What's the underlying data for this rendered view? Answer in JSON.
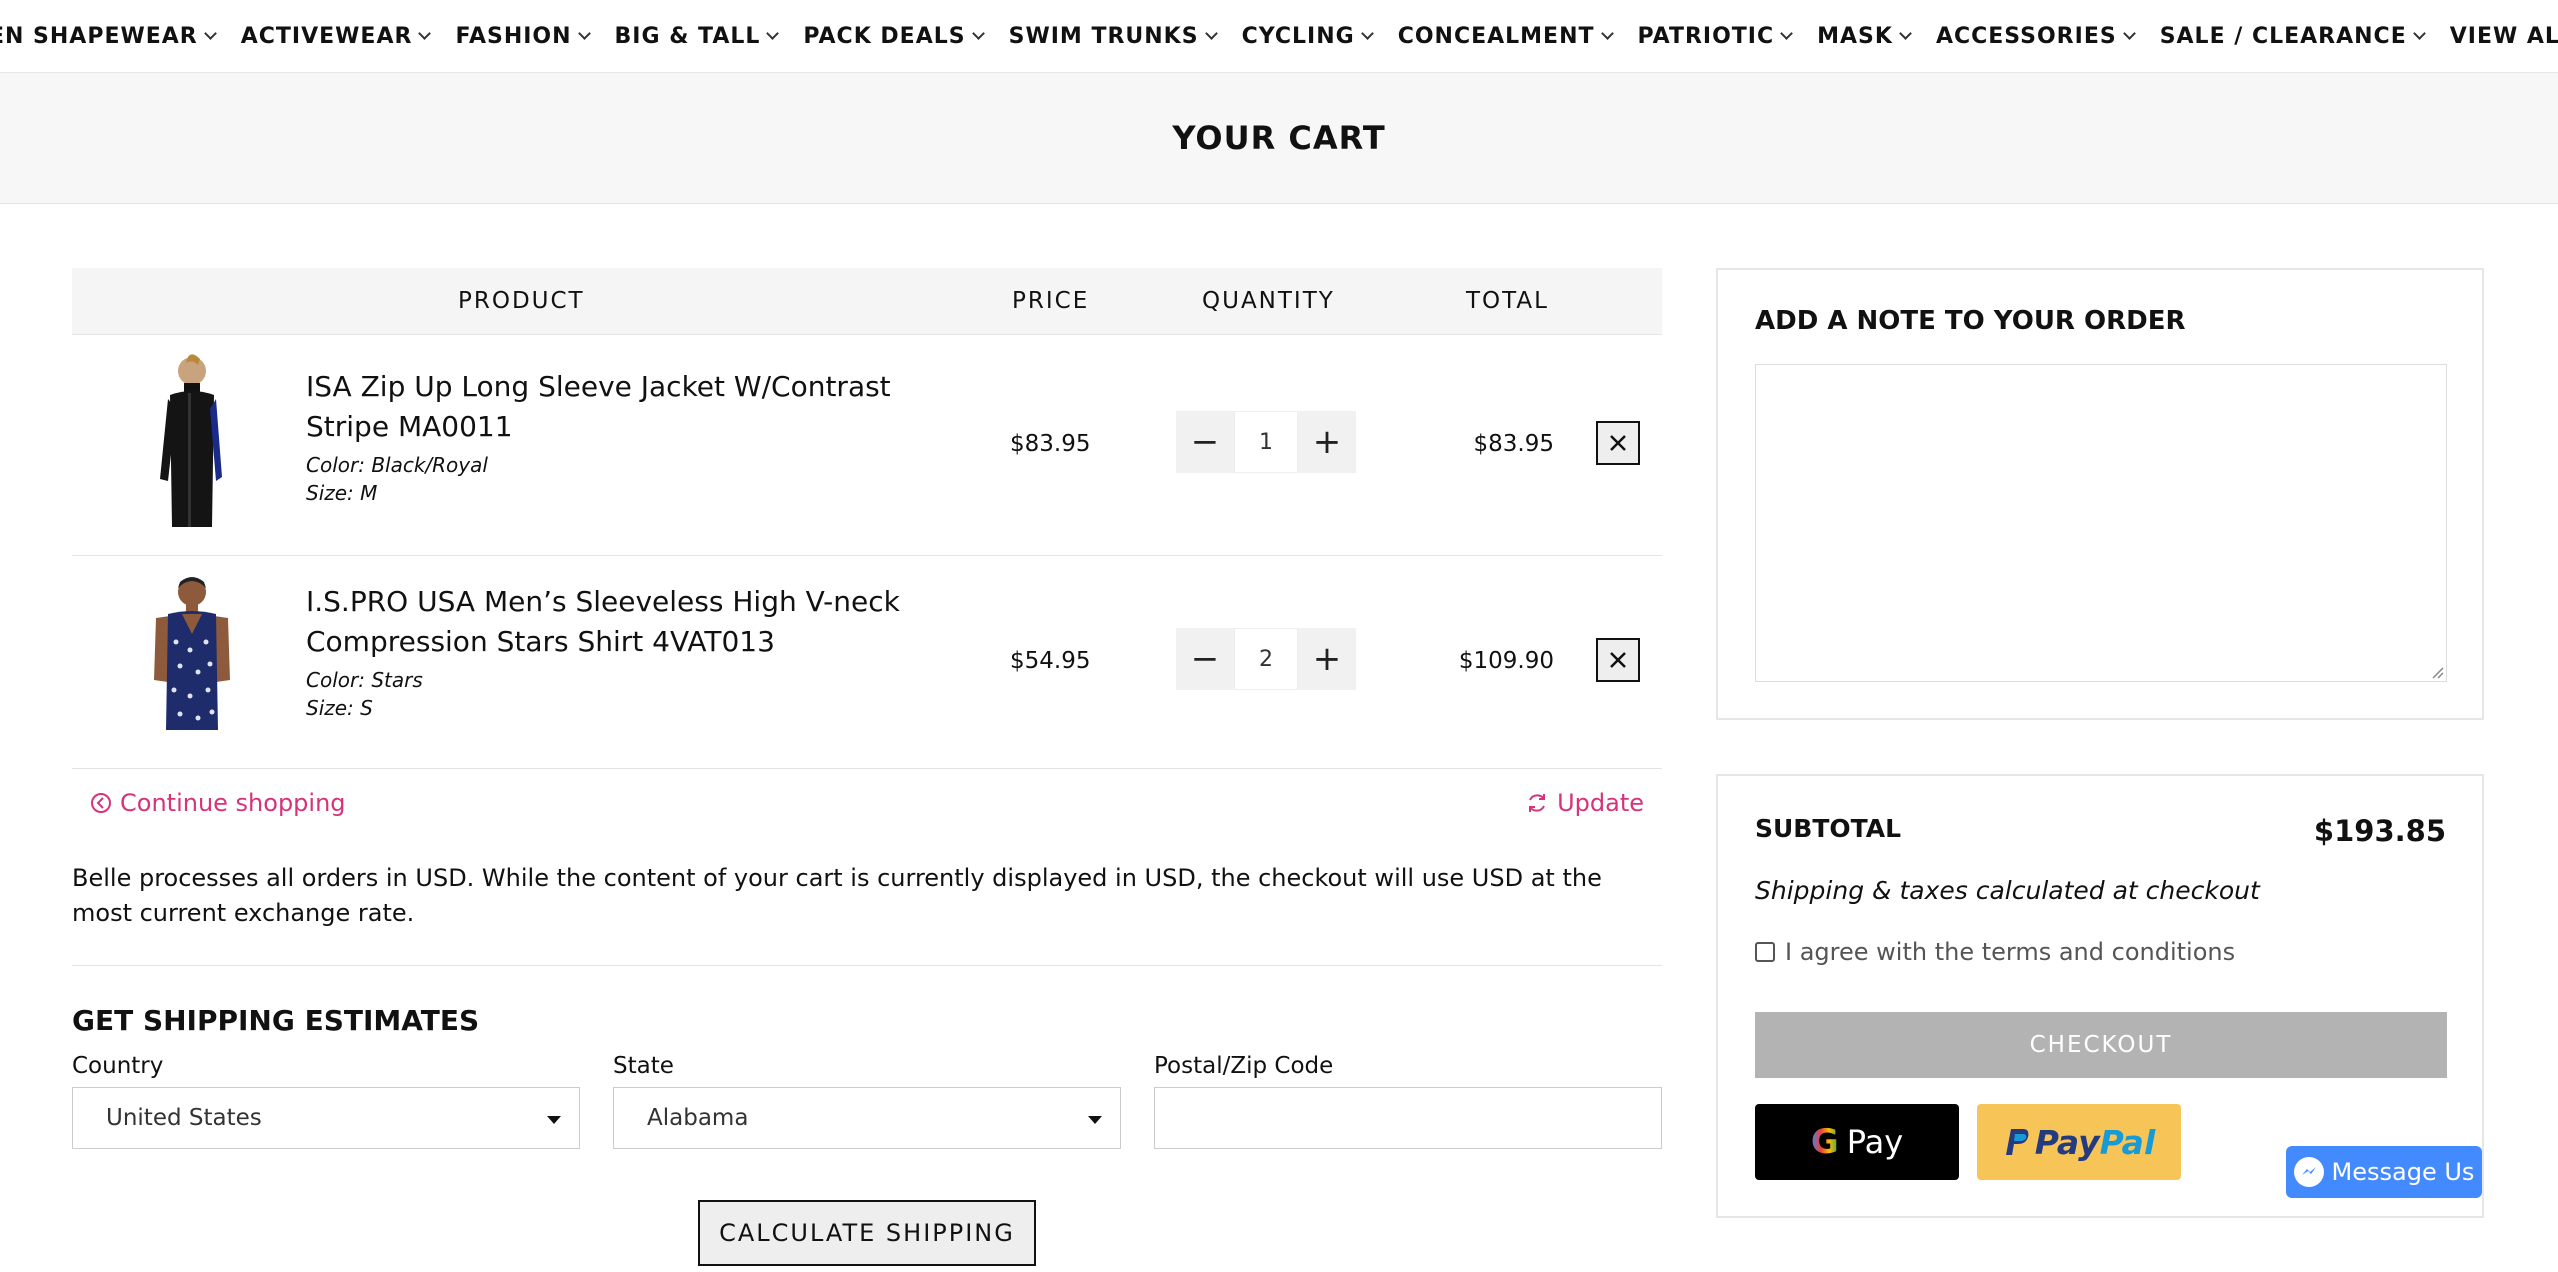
{
  "nav": {
    "items": [
      {
        "label": "MEN SHAPEWEAR"
      },
      {
        "label": "ACTIVEWEAR"
      },
      {
        "label": "FASHION"
      },
      {
        "label": "BIG & TALL"
      },
      {
        "label": "PACK DEALS"
      },
      {
        "label": "SWIM TRUNKS"
      },
      {
        "label": "CYCLING"
      },
      {
        "label": "CONCEALMENT"
      },
      {
        "label": "PATRIOTIC"
      },
      {
        "label": "MASK"
      },
      {
        "label": "ACCESSORIES"
      },
      {
        "label": "SALE / CLEARANCE"
      },
      {
        "label": "VIEW ALL"
      }
    ]
  },
  "page": {
    "title": "YOUR CART"
  },
  "table": {
    "headers": {
      "product": "PRODUCT",
      "price": "PRICE",
      "quantity": "QUANTITY",
      "total": "TOTAL"
    },
    "items": [
      {
        "name": "ISA Zip Up Long Sleeve Jacket W/Contrast Stripe MA0011",
        "color": "Color: Black/Royal",
        "size": "Size: M",
        "price": "$83.95",
        "qty": "1",
        "total": "$83.95"
      },
      {
        "name": "I.S.PRO USA Men’s Sleeveless High V-neck Compression Stars Shirt 4VAT013",
        "color": "Color: Stars",
        "size": "Size: S",
        "price": "$54.95",
        "qty": "2",
        "total": "$109.90"
      }
    ],
    "qty_minus": "−",
    "qty_plus": "+"
  },
  "actions": {
    "continue": "Continue shopping",
    "update": "Update"
  },
  "currency_note": "Belle processes all orders in USD. While the content of your cart is currently displayed in USD, the checkout will use USD at the most current exchange rate.",
  "shipping": {
    "title": "GET SHIPPING ESTIMATES",
    "country_label": "Country",
    "country_value": "United States",
    "state_label": "State",
    "state_value": "Alabama",
    "zip_label": "Postal/Zip Code",
    "zip_value": "",
    "button": "CALCULATE SHIPPING"
  },
  "order_note": {
    "title": "ADD A NOTE TO YOUR ORDER"
  },
  "summary": {
    "subtotal_label": "SUBTOTAL",
    "subtotal_value": "$193.85",
    "shipping_note": "Shipping & taxes calculated at checkout",
    "agree": "I agree with the terms and conditions",
    "checkout": "CHECKOUT",
    "gpay": "Pay",
    "paypal_a": "Pay",
    "paypal_b": "Pal"
  },
  "messenger": {
    "label": "Message Us"
  },
  "colors": {
    "accent_pink": "#d6337a",
    "messenger_blue": "#448aff",
    "paypal_yellow": "#f7c557"
  }
}
